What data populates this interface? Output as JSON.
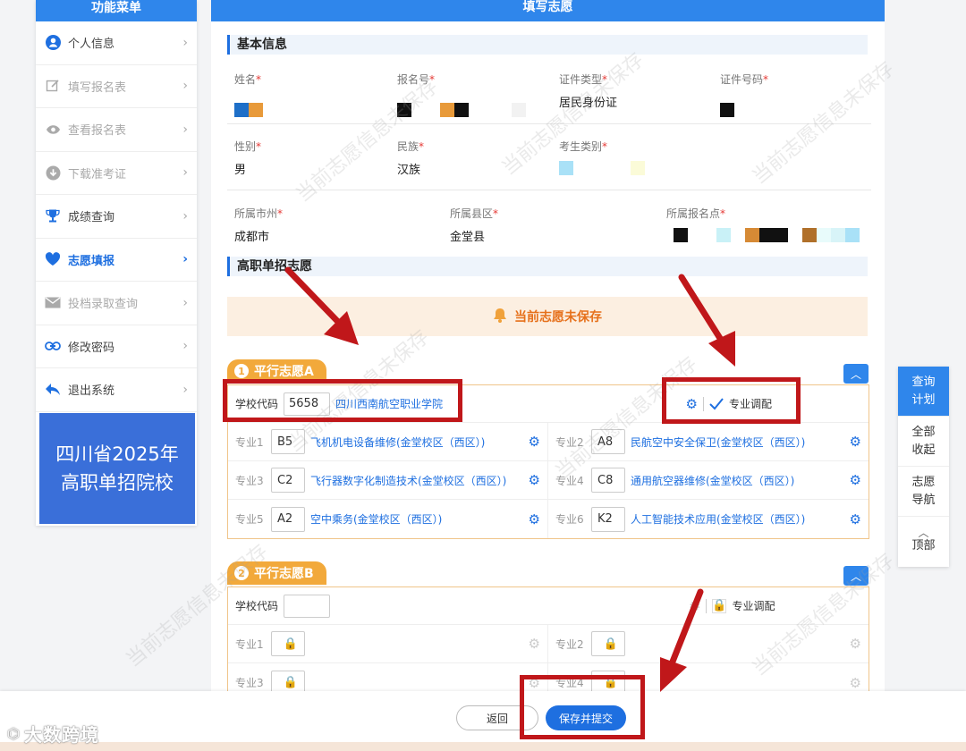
{
  "sidebar": {
    "header": "功能菜单",
    "items": [
      {
        "label": "个人信息",
        "icon": "user-icon",
        "state": "normal"
      },
      {
        "label": "填写报名表",
        "icon": "edit-icon",
        "state": "disabled"
      },
      {
        "label": "查看报名表",
        "icon": "eye-icon",
        "state": "disabled"
      },
      {
        "label": "下载准考证",
        "icon": "download-icon",
        "state": "disabled"
      },
      {
        "label": "成绩查询",
        "icon": "trophy-icon",
        "state": "normal"
      },
      {
        "label": "志愿填报",
        "icon": "heart-icon",
        "state": "active"
      },
      {
        "label": "投档录取查询",
        "icon": "mail-icon",
        "state": "disabled"
      },
      {
        "label": "修改密码",
        "icon": "link-icon",
        "state": "normal"
      },
      {
        "label": "退出系统",
        "icon": "back-arrow-icon",
        "state": "normal"
      }
    ],
    "banner_line1": "四川省2025年",
    "banner_line2": "高职单招院校"
  },
  "main": {
    "header": "填写志愿",
    "basic_title": "基本信息",
    "fields": {
      "name_label": "姓名",
      "regno_label": "报名号",
      "idtype_label": "证件类型",
      "idtype_value": "居民身份证",
      "idno_label": "证件号码",
      "gender_label": "性别",
      "gender_value": "男",
      "ethnic_label": "民族",
      "ethnic_value": "汉族",
      "category_label": "考生类别",
      "city_label": "所属市州",
      "city_value": "成都市",
      "county_label": "所属县区",
      "county_value": "金堂县",
      "site_label": "所属报名点",
      "required_mark": "*"
    },
    "vol_title": "高职单招志愿",
    "notice": "当前志愿未保存",
    "volA": {
      "num": "1",
      "title": "平行志愿A",
      "code_label": "学校代码",
      "code": "5658",
      "school": "四川西南航空职业学院",
      "adjust_label": "专业调配",
      "majors": [
        {
          "label": "专业1",
          "code": "B5",
          "name": "飞机机电设备维修(金堂校区（西区）)"
        },
        {
          "label": "专业2",
          "code": "A8",
          "name": "民航空中安全保卫(金堂校区（西区）)"
        },
        {
          "label": "专业3",
          "code": "C2",
          "name": "飞行器数字化制造技术(金堂校区（西区）)"
        },
        {
          "label": "专业4",
          "code": "C8",
          "name": "通用航空器维修(金堂校区（西区）)"
        },
        {
          "label": "专业5",
          "code": "A2",
          "name": "空中乘务(金堂校区（西区）)"
        },
        {
          "label": "专业6",
          "code": "K2",
          "name": "人工智能技术应用(金堂校区（西区）)"
        }
      ]
    },
    "volB": {
      "num": "2",
      "title": "平行志愿B",
      "code_label": "学校代码",
      "adjust_label": "专业调配",
      "majors": [
        {
          "label": "专业1"
        },
        {
          "label": "专业2"
        },
        {
          "label": "专业3"
        },
        {
          "label": "专业4"
        }
      ]
    }
  },
  "right_nav": {
    "query_line1": "查询",
    "query_line2": "计划",
    "collapse_line1": "全部",
    "collapse_line2": "收起",
    "guide_line1": "志愿",
    "guide_line2": "导航",
    "top_label": "顶部"
  },
  "bottom": {
    "back": "返回",
    "save": "保存并提交"
  },
  "brand": "大数跨境",
  "watermark": "当前志愿信息未保存",
  "colors": {
    "primary": "#2f86eb",
    "accent": "#f2a93b",
    "annotation": "#c0171a"
  }
}
